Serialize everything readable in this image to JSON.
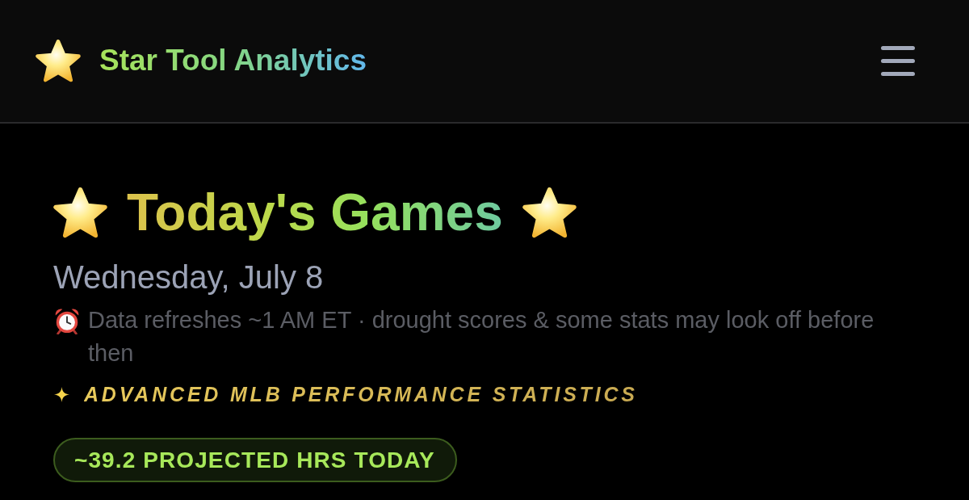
{
  "header": {
    "title": "Star Tool Analytics"
  },
  "hero": {
    "title": "Today's Games",
    "date": "Wednesday, July 8",
    "notice": "Data refreshes ~1 AM ET · drought scores & some stats may look off before then",
    "tagline": "ADVANCED MLB PERFORMANCE STATISTICS",
    "projection_badge": "~39.2 PROJECTED HRS TODAY"
  }
}
